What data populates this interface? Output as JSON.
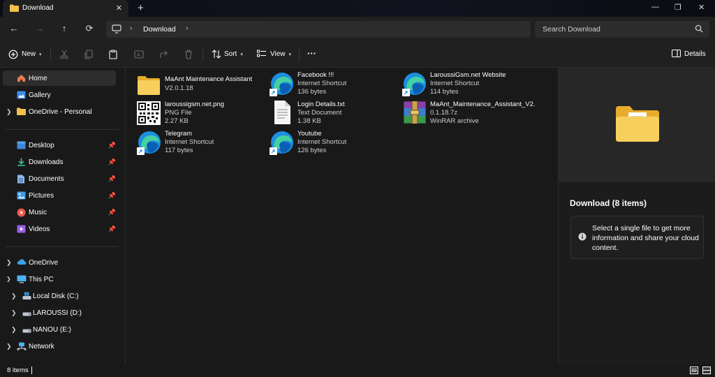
{
  "window": {
    "tab_title": "Download",
    "tab_close": "✕",
    "new_tab": "+",
    "minimize": "—",
    "maximize": "❐",
    "close": "✕"
  },
  "nav": {
    "back": "←",
    "forward": "→",
    "up": "↑",
    "refresh": "⟳",
    "breadcrumb": "Download",
    "sep": "›",
    "search_placeholder": "Search Download"
  },
  "toolbar": {
    "new_label": "New",
    "sort_label": "Sort",
    "view_label": "View",
    "more_label": "···",
    "details_label": "Details"
  },
  "sidebar": {
    "items": [
      {
        "label": "Home"
      },
      {
        "label": "Gallery"
      },
      {
        "label": "OneDrive - Personal"
      },
      {
        "label": "Desktop"
      },
      {
        "label": "Downloads"
      },
      {
        "label": "Documents"
      },
      {
        "label": "Pictures"
      },
      {
        "label": "Music"
      },
      {
        "label": "Videos"
      },
      {
        "label": "OneDrive"
      },
      {
        "label": "This PC"
      },
      {
        "label": "Local Disk (C:)"
      },
      {
        "label": "LAROUSSI (D:)"
      },
      {
        "label": "NANOU (E:)"
      },
      {
        "label": "Network"
      }
    ]
  },
  "files": [
    {
      "name": "MaAnt Maintenance Assistant",
      "type": "V2.0.1.18",
      "size": "",
      "icon": "folder-icon"
    },
    {
      "name": "Facebook !!!",
      "type": "Internet Shortcut",
      "size": "136 bytes",
      "icon": "edge-shortcut-icon"
    },
    {
      "name": "LaroussiGsm.net Website",
      "type": "Internet Shortcut",
      "size": "114 bytes",
      "icon": "edge-shortcut-icon"
    },
    {
      "name": "laroussigsm.net.png",
      "type": "PNG File",
      "size": "2.27 KB",
      "icon": "qr-code-icon"
    },
    {
      "name": "Login Details.txt",
      "type": "Text Document",
      "size": "1.38 KB",
      "icon": "text-document-icon"
    },
    {
      "name": "MaAnt_Maintenance_Assistant_V2.",
      "type": "0.1.18.7z",
      "size": "WinRAR archive",
      "icon": "winrar-archive-icon"
    },
    {
      "name": "Telegram",
      "type": "Internet Shortcut",
      "size": "117 bytes",
      "icon": "edge-shortcut-icon"
    },
    {
      "name": "Youtube",
      "type": "Internet Shortcut",
      "size": "126 bytes",
      "icon": "edge-shortcut-icon"
    }
  ],
  "details": {
    "title": "Download (8 items)",
    "info": "Select a single file to get more information and share your cloud content."
  },
  "status": {
    "count": "8 items"
  },
  "colors": {
    "background": "#191919",
    "panel": "#202020",
    "folder": "#f2c04c",
    "selection": "#2d2d2d"
  }
}
